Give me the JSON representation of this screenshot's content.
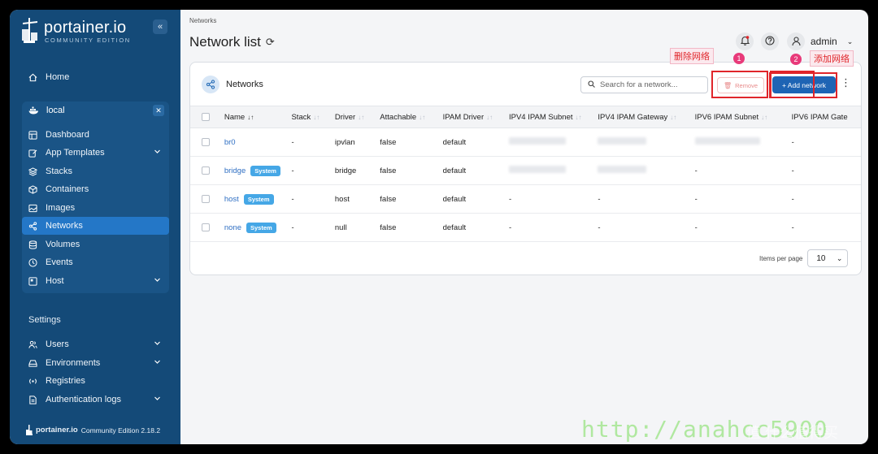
{
  "sidebar": {
    "logo_name": "portainer.io",
    "logo_sub": "COMMUNITY EDITION",
    "collapse_glyph": "«",
    "home": "Home",
    "environment": "local",
    "env_items": [
      {
        "label": "Dashboard",
        "icon": "dashboard-icon"
      },
      {
        "label": "App Templates",
        "icon": "edit-icon",
        "expandable": true
      },
      {
        "label": "Stacks",
        "icon": "layers-icon"
      },
      {
        "label": "Containers",
        "icon": "box-icon"
      },
      {
        "label": "Images",
        "icon": "image-icon"
      },
      {
        "label": "Networks",
        "icon": "share-icon",
        "active": true
      },
      {
        "label": "Volumes",
        "icon": "database-icon"
      },
      {
        "label": "Events",
        "icon": "clock-icon"
      },
      {
        "label": "Host",
        "icon": "server-icon",
        "expandable": true
      }
    ],
    "settings_label": "Settings",
    "settings_items": [
      {
        "label": "Users",
        "icon": "user-icon",
        "expandable": true
      },
      {
        "label": "Environments",
        "icon": "hdd-icon",
        "expandable": true
      },
      {
        "label": "Registries",
        "icon": "radio-icon"
      },
      {
        "label": "Authentication logs",
        "icon": "file-icon",
        "expandable": true
      }
    ],
    "footer_brand": "portainer.io",
    "footer_version": "Community Edition 2.18.2"
  },
  "header": {
    "breadcrumb": "Networks",
    "title": "Network list",
    "user": "admin"
  },
  "card": {
    "title": "Networks",
    "search_placeholder": "Search for a network...",
    "remove_label": "Remove",
    "add_label": "+ Add network",
    "columns": [
      "Name",
      "Stack",
      "Driver",
      "Attachable",
      "IPAM Driver",
      "IPV4 IPAM Subnet",
      "IPV4 IPAM Gateway",
      "IPV6 IPAM Subnet",
      "IPV6 IPAM Gate"
    ],
    "rows": [
      {
        "name": "br0",
        "system": false,
        "stack": "-",
        "driver": "ipvlan",
        "attachable": "false",
        "ipam_driver": "default",
        "ipv4_subnet": "",
        "ipv4_gateway": "",
        "ipv6_subnet": "",
        "ipv6_gateway": "-",
        "blurred": [
          true,
          true,
          true
        ]
      },
      {
        "name": "bridge",
        "system": true,
        "stack": "-",
        "driver": "bridge",
        "attachable": "false",
        "ipam_driver": "default",
        "ipv4_subnet": "",
        "ipv4_gateway": "",
        "ipv6_subnet": "-",
        "ipv6_gateway": "-",
        "blurred": [
          true,
          true,
          false
        ]
      },
      {
        "name": "host",
        "system": true,
        "stack": "-",
        "driver": "host",
        "attachable": "false",
        "ipam_driver": "default",
        "ipv4_subnet": "-",
        "ipv4_gateway": "-",
        "ipv6_subnet": "-",
        "ipv6_gateway": "-",
        "blurred": [
          false,
          false,
          false
        ]
      },
      {
        "name": "none",
        "system": true,
        "stack": "-",
        "driver": "null",
        "attachable": "false",
        "ipam_driver": "default",
        "ipv4_subnet": "-",
        "ipv4_gateway": "-",
        "ipv6_subnet": "-",
        "ipv6_gateway": "-",
        "blurred": [
          false,
          false,
          false
        ]
      }
    ],
    "system_badge": "System",
    "items_per_page_label": "Items per page",
    "items_per_page_value": "10"
  },
  "annotations": {
    "remove_label": "删除网络",
    "remove_num": "1",
    "add_label": "添加网络",
    "add_num": "2",
    "color": "#e0252a"
  },
  "watermark": {
    "url": "http://anahcc5900",
    "site": "值 什么值得买"
  }
}
